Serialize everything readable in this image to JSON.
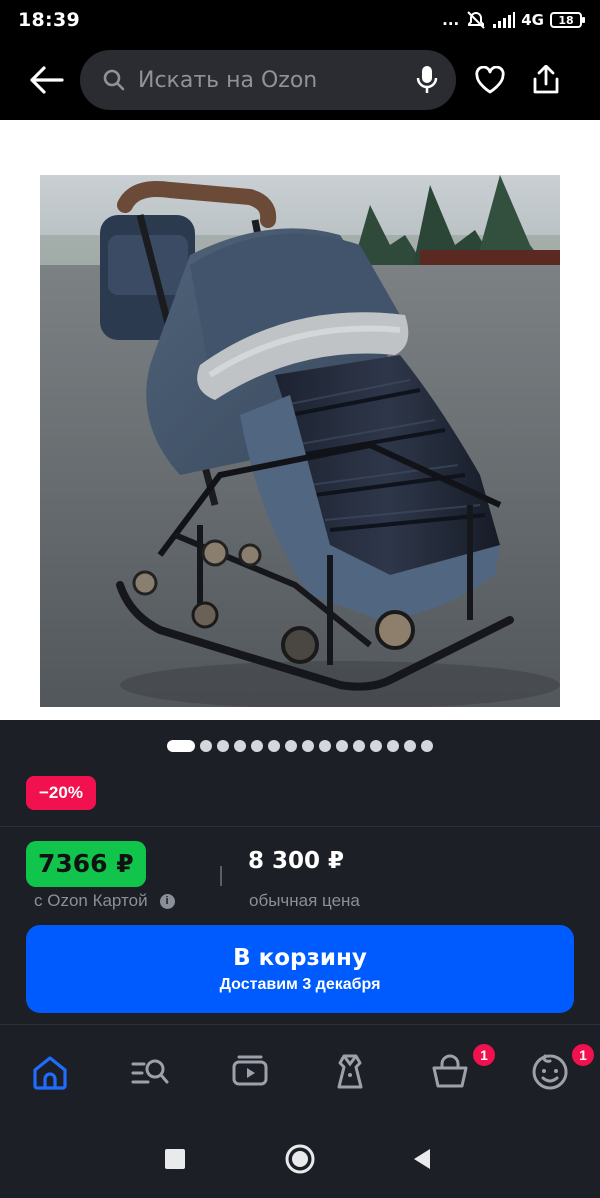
{
  "status_bar": {
    "time": "18:39",
    "extra": "...",
    "network": "4G",
    "battery": "18"
  },
  "app_bar": {
    "search_placeholder": "Искать на Ozon"
  },
  "gallery": {
    "total_images": 15,
    "active_index": 0
  },
  "product": {
    "discount": "−20%",
    "card_price": "7366 ₽",
    "card_price_label": "с Ozon Картой",
    "regular_price": "8 300 ₽",
    "regular_price_label": "обычная цена"
  },
  "cart_button": {
    "label": "В корзину",
    "delivery": "Доставим 3 декабря"
  },
  "tabbar": {
    "items": [
      {
        "icon": "home-icon",
        "active": true
      },
      {
        "icon": "catalog-search-icon"
      },
      {
        "icon": "video-icon"
      },
      {
        "icon": "fresh-icon"
      },
      {
        "icon": "basket-icon",
        "badge": "1"
      },
      {
        "icon": "profile-icon",
        "badge": "1"
      }
    ]
  },
  "colors": {
    "accent": "#005bff",
    "discount": "#f0114e",
    "card_price": "#10c44c",
    "background": "#1c1f26"
  }
}
